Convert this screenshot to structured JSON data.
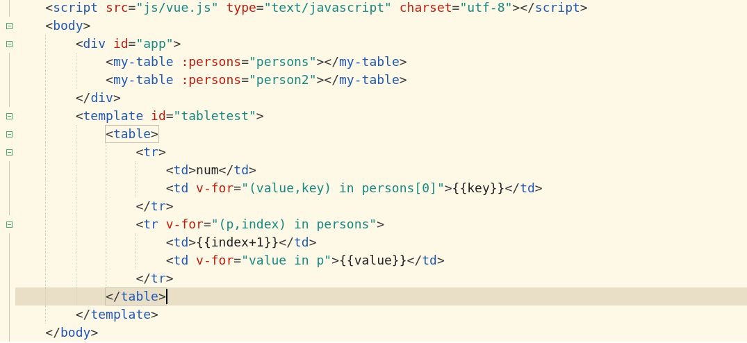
{
  "editor": {
    "lines": [
      {
        "current": false,
        "matched": false,
        "tokens": [
          {
            "kind": "punct",
            "text": "<"
          },
          {
            "kind": "tag",
            "text": "script"
          },
          {
            "kind": "attr",
            "text": " src"
          },
          {
            "kind": "punct",
            "text": "="
          },
          {
            "kind": "string",
            "text": "\"js/vue.js\""
          },
          {
            "kind": "attr",
            "text": " type"
          },
          {
            "kind": "punct",
            "text": "="
          },
          {
            "kind": "string",
            "text": "\"text/javascript\""
          },
          {
            "kind": "attr",
            "text": " charset"
          },
          {
            "kind": "punct",
            "text": "="
          },
          {
            "kind": "string",
            "text": "\"utf-8\""
          },
          {
            "kind": "punct",
            "text": "></"
          },
          {
            "kind": "tag",
            "text": "script"
          },
          {
            "kind": "punct",
            "text": ">"
          }
        ]
      },
      {
        "current": false,
        "matched": false,
        "tokens": [
          {
            "kind": "punct",
            "text": "<"
          },
          {
            "kind": "tag",
            "text": "body"
          },
          {
            "kind": "punct",
            "text": ">"
          }
        ],
        "children": [
          {
            "current": false,
            "matched": false,
            "tokens": [
              {
                "kind": "punct",
                "text": "<"
              },
              {
                "kind": "tag",
                "text": "div"
              },
              {
                "kind": "attr",
                "text": " id"
              },
              {
                "kind": "punct",
                "text": "="
              },
              {
                "kind": "string",
                "text": "\"app\""
              },
              {
                "kind": "punct",
                "text": ">"
              }
            ],
            "children": [
              {
                "current": false,
                "matched": false,
                "tokens": [
                  {
                    "kind": "punct",
                    "text": "<"
                  },
                  {
                    "kind": "tag",
                    "text": "my-table"
                  },
                  {
                    "kind": "attr",
                    "text": " :persons"
                  },
                  {
                    "kind": "punct",
                    "text": "="
                  },
                  {
                    "kind": "string",
                    "text": "\"persons\""
                  },
                  {
                    "kind": "punct",
                    "text": "></"
                  },
                  {
                    "kind": "tag",
                    "text": "my-table"
                  },
                  {
                    "kind": "punct",
                    "text": ">"
                  }
                ]
              },
              {
                "current": false,
                "matched": false,
                "tokens": [
                  {
                    "kind": "punct",
                    "text": "<"
                  },
                  {
                    "kind": "tag",
                    "text": "my-table"
                  },
                  {
                    "kind": "attr",
                    "text": " :persons"
                  },
                  {
                    "kind": "punct",
                    "text": "="
                  },
                  {
                    "kind": "string",
                    "text": "\"person2\""
                  },
                  {
                    "kind": "punct",
                    "text": "></"
                  },
                  {
                    "kind": "tag",
                    "text": "my-table"
                  },
                  {
                    "kind": "punct",
                    "text": ">"
                  }
                ]
              }
            ]
          },
          {
            "current": false,
            "matched": false,
            "tokens": [
              {
                "kind": "punct",
                "text": "</"
              },
              {
                "kind": "tag",
                "text": "div"
              },
              {
                "kind": "punct",
                "text": ">"
              }
            ]
          },
          {
            "current": false,
            "matched": false,
            "tokens": [
              {
                "kind": "punct",
                "text": "<"
              },
              {
                "kind": "tag",
                "text": "template"
              },
              {
                "kind": "attr",
                "text": " id"
              },
              {
                "kind": "punct",
                "text": "="
              },
              {
                "kind": "string",
                "text": "\"tabletest\""
              },
              {
                "kind": "punct",
                "text": ">"
              }
            ],
            "children": [
              {
                "current": false,
                "matched": true,
                "tokens": [
                  {
                    "kind": "punct",
                    "text": "<"
                  },
                  {
                    "kind": "tag",
                    "text": "table"
                  },
                  {
                    "kind": "punct",
                    "text": ">"
                  }
                ],
                "children": [
                  {
                    "current": false,
                    "matched": false,
                    "tokens": [
                      {
                        "kind": "punct",
                        "text": "<"
                      },
                      {
                        "kind": "tag",
                        "text": "tr"
                      },
                      {
                        "kind": "punct",
                        "text": ">"
                      }
                    ],
                    "children": [
                      {
                        "current": false,
                        "matched": false,
                        "tokens": [
                          {
                            "kind": "punct",
                            "text": "<"
                          },
                          {
                            "kind": "tag",
                            "text": "td"
                          },
                          {
                            "kind": "punct",
                            "text": ">"
                          },
                          {
                            "kind": "text",
                            "text": "num"
                          },
                          {
                            "kind": "punct",
                            "text": "</"
                          },
                          {
                            "kind": "tag",
                            "text": "td"
                          },
                          {
                            "kind": "punct",
                            "text": ">"
                          }
                        ]
                      },
                      {
                        "current": false,
                        "matched": false,
                        "tokens": [
                          {
                            "kind": "punct",
                            "text": "<"
                          },
                          {
                            "kind": "tag",
                            "text": "td"
                          },
                          {
                            "kind": "attr",
                            "text": " v-for"
                          },
                          {
                            "kind": "punct",
                            "text": "="
                          },
                          {
                            "kind": "string",
                            "text": "\"(value,key) in persons[0]\""
                          },
                          {
                            "kind": "punct",
                            "text": ">"
                          },
                          {
                            "kind": "text",
                            "text": "{{key}}"
                          },
                          {
                            "kind": "punct",
                            "text": "</"
                          },
                          {
                            "kind": "tag",
                            "text": "td"
                          },
                          {
                            "kind": "punct",
                            "text": ">"
                          }
                        ]
                      }
                    ]
                  },
                  {
                    "current": false,
                    "matched": false,
                    "tokens": [
                      {
                        "kind": "punct",
                        "text": "</"
                      },
                      {
                        "kind": "tag",
                        "text": "tr"
                      },
                      {
                        "kind": "punct",
                        "text": ">"
                      }
                    ]
                  },
                  {
                    "current": false,
                    "matched": false,
                    "tokens": [
                      {
                        "kind": "punct",
                        "text": "<"
                      },
                      {
                        "kind": "tag",
                        "text": "tr"
                      },
                      {
                        "kind": "attr",
                        "text": " v-for"
                      },
                      {
                        "kind": "punct",
                        "text": "="
                      },
                      {
                        "kind": "string",
                        "text": "\"(p,index) in persons\""
                      },
                      {
                        "kind": "punct",
                        "text": ">"
                      }
                    ],
                    "children": [
                      {
                        "current": false,
                        "matched": false,
                        "tokens": [
                          {
                            "kind": "punct",
                            "text": "<"
                          },
                          {
                            "kind": "tag",
                            "text": "td"
                          },
                          {
                            "kind": "punct",
                            "text": ">"
                          },
                          {
                            "kind": "text",
                            "text": "{{index+1}}"
                          },
                          {
                            "kind": "punct",
                            "text": "</"
                          },
                          {
                            "kind": "tag",
                            "text": "td"
                          },
                          {
                            "kind": "punct",
                            "text": ">"
                          }
                        ]
                      },
                      {
                        "current": false,
                        "matched": false,
                        "tokens": [
                          {
                            "kind": "punct",
                            "text": "<"
                          },
                          {
                            "kind": "tag",
                            "text": "td"
                          },
                          {
                            "kind": "attr",
                            "text": " v-for"
                          },
                          {
                            "kind": "punct",
                            "text": "="
                          },
                          {
                            "kind": "string",
                            "text": "\"value in p\""
                          },
                          {
                            "kind": "punct",
                            "text": ">"
                          },
                          {
                            "kind": "text",
                            "text": "{{value}}"
                          },
                          {
                            "kind": "punct",
                            "text": "</"
                          },
                          {
                            "kind": "tag",
                            "text": "td"
                          },
                          {
                            "kind": "punct",
                            "text": ">"
                          }
                        ]
                      }
                    ]
                  },
                  {
                    "current": false,
                    "matched": false,
                    "tokens": [
                      {
                        "kind": "punct",
                        "text": "</"
                      },
                      {
                        "kind": "tag",
                        "text": "tr"
                      },
                      {
                        "kind": "punct",
                        "text": ">"
                      }
                    ]
                  }
                ]
              },
              {
                "current": true,
                "matched": true,
                "tokens": [
                  {
                    "kind": "punct",
                    "text": "</"
                  },
                  {
                    "kind": "tag",
                    "text": "table"
                  },
                  {
                    "kind": "punct",
                    "text": ">"
                  }
                ]
              }
            ]
          },
          {
            "current": false,
            "matched": false,
            "tokens": [
              {
                "kind": "punct",
                "text": "</"
              },
              {
                "kind": "tag",
                "text": "template"
              },
              {
                "kind": "punct",
                "text": ">"
              }
            ]
          }
        ]
      },
      {
        "current": false,
        "matched": false,
        "tokens": [
          {
            "kind": "punct",
            "text": "</"
          },
          {
            "kind": "tag",
            "text": "body"
          },
          {
            "kind": "punct",
            "text": ">"
          }
        ]
      }
    ]
  }
}
